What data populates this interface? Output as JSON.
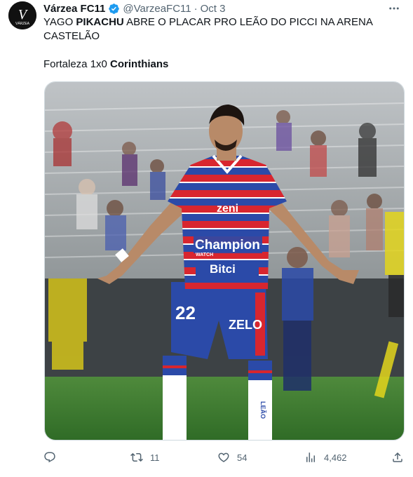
{
  "tweet": {
    "author_name": "Várzea FC11",
    "handle": "@VarzeaFC11",
    "separator": "·",
    "time": "Oct 3",
    "avatar_text": "V",
    "avatar_subtext": "VÁRZEA",
    "line1_pre": "YAGO ",
    "line1_bold": "PIKACHU",
    "line1_post": " ABRE O PLACAR PRO LEÃO DO PICCI NA ARENA CASTELÃO",
    "score_pre": "Fortaleza 1x0 ",
    "score_bold": "Corinthians"
  },
  "media": {
    "alt": "Player celebrating in stadium",
    "shirt_number": "22",
    "sponsor_main": "Champion",
    "sponsor_sub": "WATCH",
    "sponsor_bottom": "Bitci",
    "sponsor_top": "zeni",
    "shorts_brand": "ZELO",
    "sock_text": "LEÃO"
  },
  "actions": {
    "replies": "",
    "retweets": "11",
    "likes": "54",
    "views": "4,462"
  },
  "colors": {
    "accent": "#1d9bf0",
    "muted": "#536471",
    "shirt_red": "#d8262f",
    "shirt_blue": "#2b4aa8"
  }
}
